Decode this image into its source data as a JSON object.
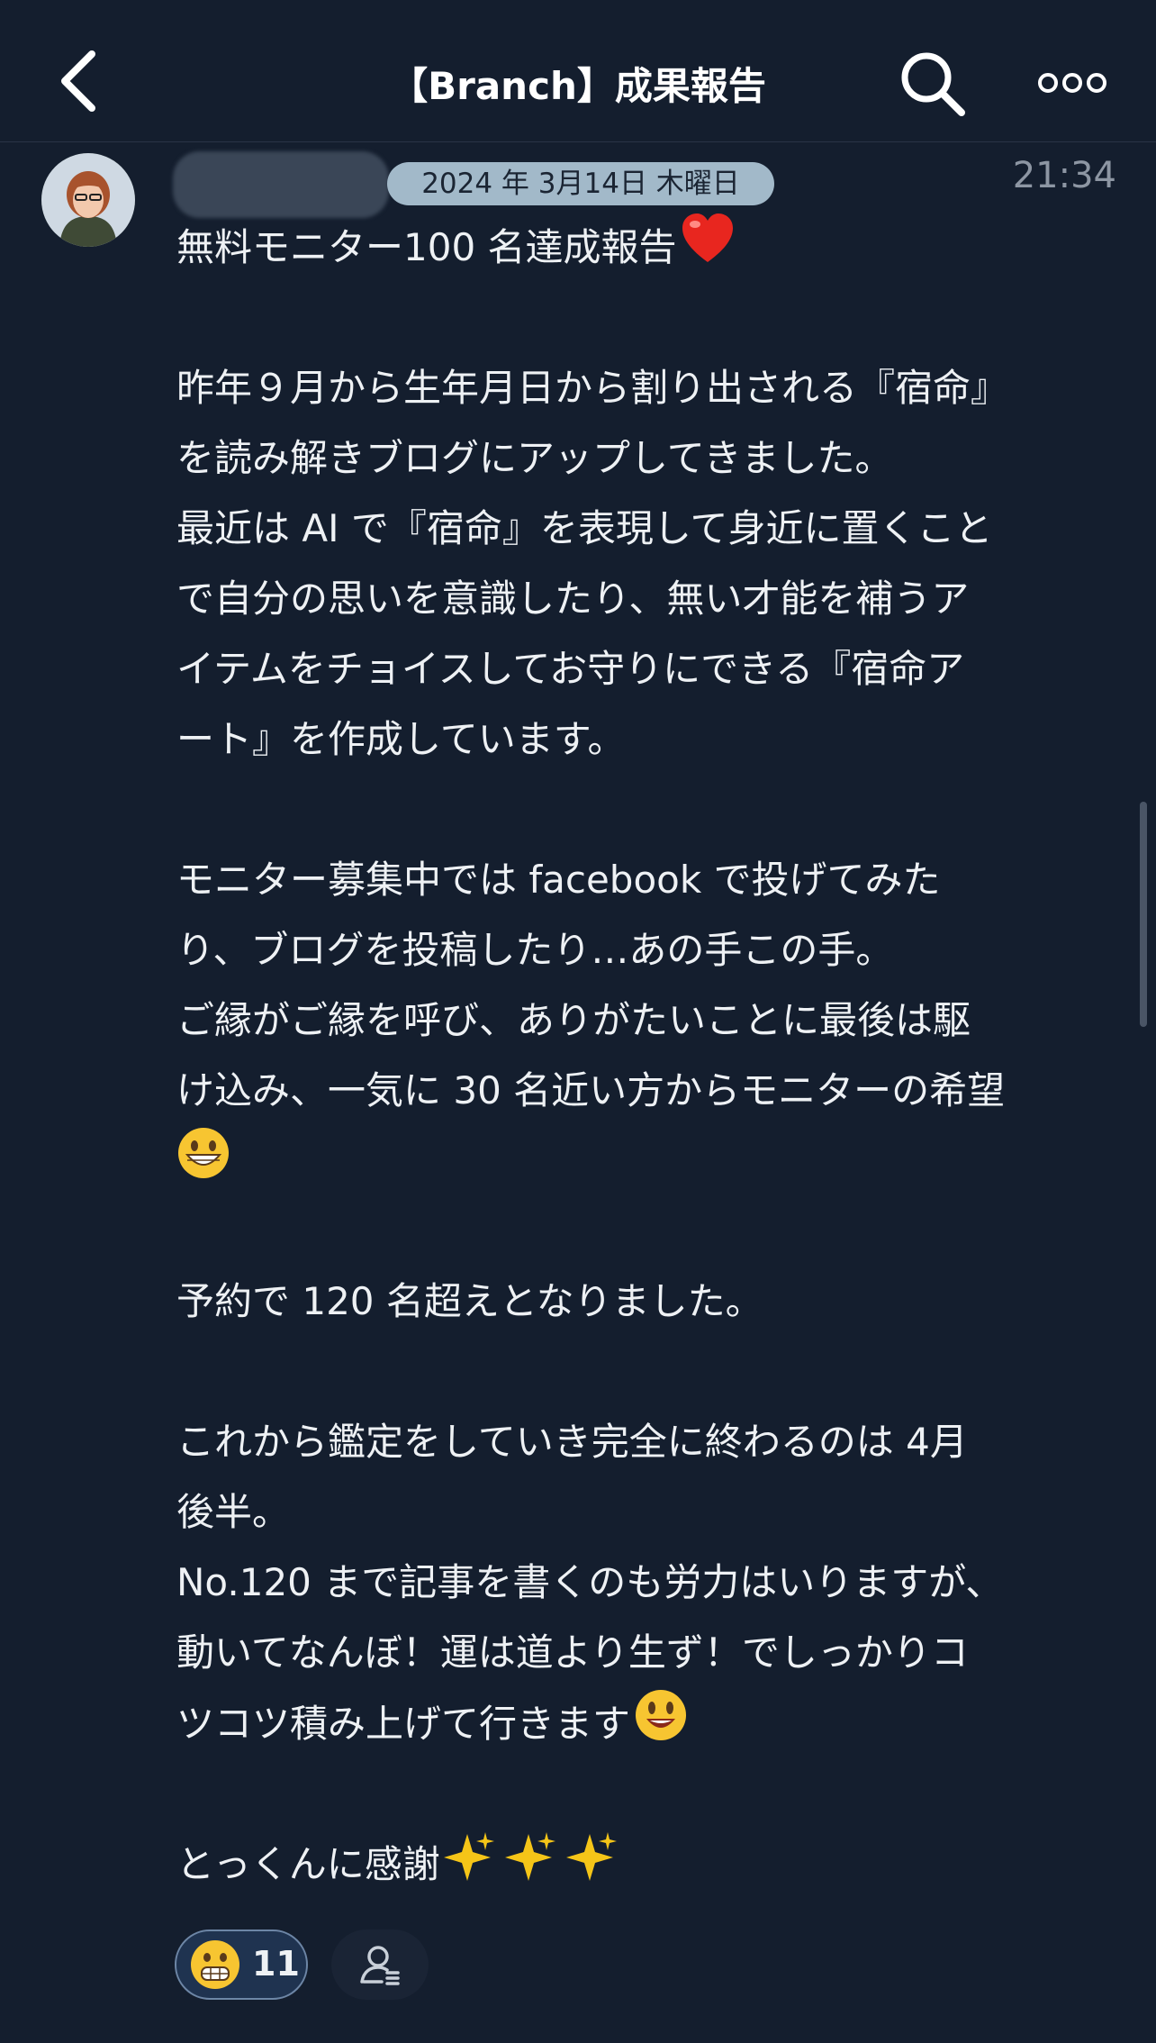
{
  "header": {
    "title": "【Branch】成果報告",
    "back_icon": "chevron-left-icon",
    "search_icon": "search-icon",
    "more_icon": "more-horizontal-icon"
  },
  "message": {
    "date": "2024 年 3月14日 木曜日",
    "time": "21:34",
    "lines": [
      "無料モニター100 名達成報告",
      "",
      "昨年９月から生年月日から割り出される『宿命』",
      "を読み解きブログにアップしてきました。",
      "最近は AI で『宿命』を表現して身近に置くこと",
      "で自分の思いを意識したり、無い才能を補うア",
      "イテムをチョイスしてお守りにできる『宿命ア",
      "ート』を作成しています。",
      "",
      "モニター募集中では facebook で投げてみた",
      "り、ブログを投稿したり…あの手この手。",
      "ご縁がご縁を呼び、ありがたいことに最後は駆",
      "け込み、一気に 30 名近い方からモニターの希望",
      "",
      "",
      "予約で 120 名超えとなりました。",
      "",
      "これから鑑定をしていき完全に終わるのは 4月",
      "後半。",
      "No.120 まで記事を書くのも労力はいりますが、",
      "動いてなんぼ！運は道より生ず！でしっかりコ",
      "ツコツ積み上げて行きます",
      "",
      "とっくんに感謝"
    ]
  },
  "reaction": {
    "count": "11",
    "icon": "grinning-face-emoji-icon"
  },
  "colors": {
    "background": "#141e2e",
    "date_pill": "#a2b9c9",
    "reaction_border": "#6d86a6"
  }
}
